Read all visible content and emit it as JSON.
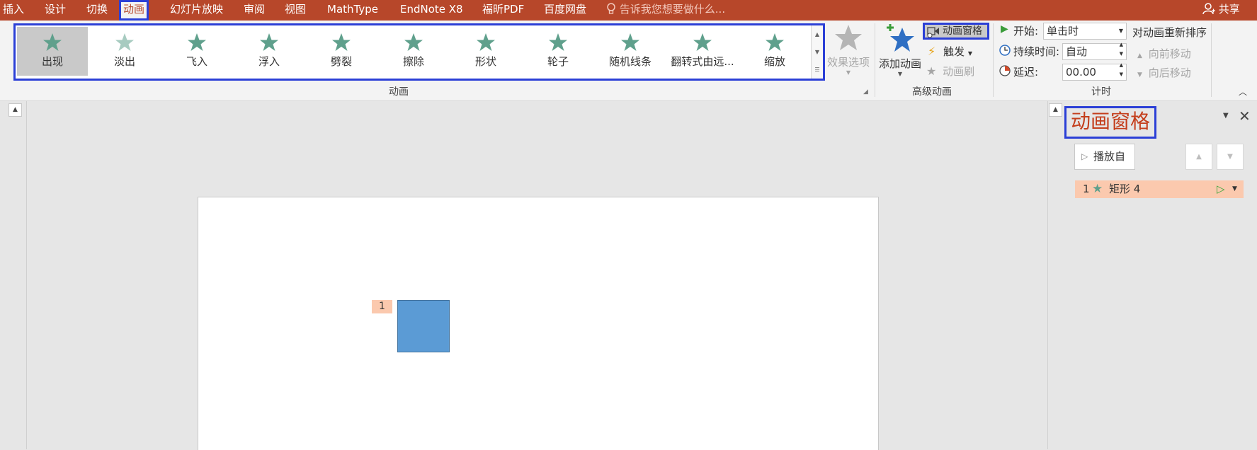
{
  "tabs": [
    {
      "label": "插入",
      "active": false
    },
    {
      "label": "设计",
      "active": false
    },
    {
      "label": "切换",
      "active": false
    },
    {
      "label": "动画",
      "active": true
    },
    {
      "label": "幻灯片放映",
      "active": false
    },
    {
      "label": "审阅",
      "active": false
    },
    {
      "label": "视图",
      "active": false
    },
    {
      "label": "MathType",
      "active": false
    },
    {
      "label": "EndNote X8",
      "active": false
    },
    {
      "label": "福昕PDF",
      "active": false
    },
    {
      "label": "百度网盘",
      "active": false
    }
  ],
  "tell_me": "告诉我您想要做什么...",
  "share": "共享",
  "animation_gallery": {
    "items": [
      {
        "label": "出现",
        "selected": true
      },
      {
        "label": "淡出"
      },
      {
        "label": "飞入"
      },
      {
        "label": "浮入"
      },
      {
        "label": "劈裂"
      },
      {
        "label": "擦除"
      },
      {
        "label": "形状"
      },
      {
        "label": "轮子"
      },
      {
        "label": "随机线条"
      },
      {
        "label": "翻转式由远..."
      },
      {
        "label": "缩放"
      }
    ],
    "group_label": "动画"
  },
  "effect_options": "效果选项",
  "advanced": {
    "add_animation": "添加动画",
    "animation_pane": "动画窗格",
    "trigger": "触发",
    "painter": "动画刷",
    "group_label": "高级动画"
  },
  "timing": {
    "start_label": "开始:",
    "start_value": "单击时",
    "duration_label": "持续时间:",
    "duration_value": "自动",
    "delay_label": "延迟:",
    "delay_value": "00.00",
    "reorder_title": "对动画重新排序",
    "move_earlier": "向前移动",
    "move_later": "向后移动",
    "group_label": "计时"
  },
  "slide": {
    "anim_marker": "1"
  },
  "pane": {
    "title": "动画窗格",
    "play_from": "播放自",
    "item": {
      "number": "1",
      "name": "矩形 4"
    }
  },
  "colors": {
    "accent": "#b7472a",
    "highlight": "#2b3fd6",
    "star": "#5fa08c",
    "shape_fill": "#5b9bd5",
    "item_bg": "#fbc9ae"
  }
}
